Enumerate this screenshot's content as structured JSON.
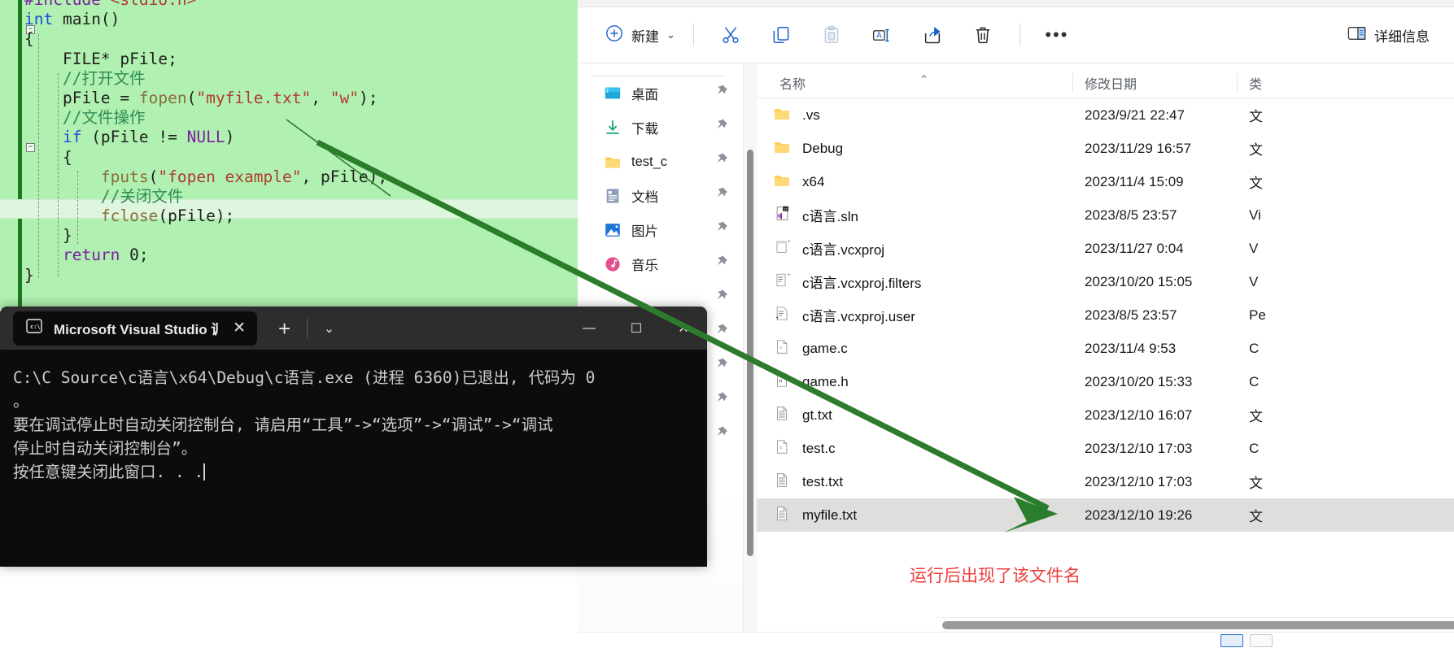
{
  "editor": {
    "lines": [
      {
        "id": "l0",
        "segments": [
          {
            "t": "#include ",
            "c": "pp"
          },
          {
            "t": "<stdio.h>",
            "c": "ppfile"
          }
        ]
      },
      {
        "id": "l1",
        "segments": [
          {
            "t": "int",
            "c": "kw"
          },
          {
            "t": " main()",
            "c": "pl"
          }
        ]
      },
      {
        "id": "l2",
        "segments": [
          {
            "t": "{",
            "c": "pl"
          }
        ]
      },
      {
        "id": "l3",
        "segments": [
          {
            "t": "    FILE* pFile;",
            "c": "pl"
          }
        ]
      },
      {
        "id": "l4",
        "segments": [
          {
            "t": "    //打开文件",
            "c": "cmt"
          }
        ]
      },
      {
        "id": "l5",
        "segments": [
          {
            "t": "    pFile = ",
            "c": "pl"
          },
          {
            "t": "fopen",
            "c": "fn"
          },
          {
            "t": "(",
            "c": "pl"
          },
          {
            "t": "\"myfile.txt\"",
            "c": "str"
          },
          {
            "t": ", ",
            "c": "pl"
          },
          {
            "t": "\"w\"",
            "c": "str"
          },
          {
            "t": ");",
            "c": "pl"
          }
        ]
      },
      {
        "id": "l6",
        "segments": [
          {
            "t": "    //文件操作",
            "c": "cmt"
          }
        ]
      },
      {
        "id": "l7",
        "segments": [
          {
            "t": "    ",
            "c": "pl"
          },
          {
            "t": "if",
            "c": "kw"
          },
          {
            "t": " (pFile != ",
            "c": "pl"
          },
          {
            "t": "NULL",
            "c": "kw2"
          },
          {
            "t": ")",
            "c": "pl"
          }
        ]
      },
      {
        "id": "l8",
        "segments": [
          {
            "t": "    {",
            "c": "pl"
          }
        ]
      },
      {
        "id": "l9",
        "segments": [
          {
            "t": "        ",
            "c": "pl"
          },
          {
            "t": "fputs",
            "c": "fn"
          },
          {
            "t": "(",
            "c": "pl"
          },
          {
            "t": "\"fopen example\"",
            "c": "str"
          },
          {
            "t": ", pFile);",
            "c": "pl"
          }
        ]
      },
      {
        "id": "l10",
        "segments": [
          {
            "t": "        //关闭文件",
            "c": "cmt"
          }
        ]
      },
      {
        "id": "l11",
        "segments": [
          {
            "t": "        ",
            "c": "pl"
          },
          {
            "t": "fclose",
            "c": "fn"
          },
          {
            "t": "(pFile);",
            "c": "pl"
          }
        ]
      },
      {
        "id": "l12",
        "segments": [
          {
            "t": "    }",
            "c": "pl"
          }
        ]
      },
      {
        "id": "l13",
        "segments": [
          {
            "t": "    ",
            "c": "pl"
          },
          {
            "t": "return",
            "c": "kw2"
          },
          {
            "t": " 0;",
            "c": "pl"
          }
        ]
      },
      {
        "id": "l14",
        "segments": [
          {
            "t": "}",
            "c": "pl"
          }
        ]
      }
    ]
  },
  "explorer": {
    "toolbar": {
      "new_label": "新建",
      "new_chevron": "⌄",
      "cut_label": "剪切",
      "copy_label": "复制",
      "paste_label": "粘贴",
      "rename_label": "重命名",
      "share_label": "共享",
      "delete_label": "删除",
      "more_label": "•••",
      "details_label": "详细信息"
    },
    "nav_items": [
      {
        "icon": "desktop-icon",
        "label": "桌面",
        "pinned": true
      },
      {
        "icon": "download-icon",
        "label": "下载",
        "pinned": true
      },
      {
        "icon": "folder-icon",
        "label": "test_c",
        "pinned": true
      },
      {
        "icon": "documents-icon",
        "label": "文档",
        "pinned": true
      },
      {
        "icon": "pictures-icon",
        "label": "图片",
        "pinned": true
      },
      {
        "icon": "music-icon",
        "label": "音乐",
        "pinned": true
      },
      {
        "icon": "blank-icon",
        "label": "",
        "pinned": true
      },
      {
        "icon": "blank-icon",
        "label": "",
        "pinned": true
      },
      {
        "icon": "blank-icon",
        "label": "",
        "pinned": true
      },
      {
        "icon": "blank-icon",
        "label": "",
        "pinned": true
      },
      {
        "icon": "blank-icon",
        "label": "",
        "pinned": true
      }
    ],
    "columns": {
      "name": "名称",
      "date": "修改日期",
      "type": "类"
    },
    "files": [
      {
        "icon": "folder-icon",
        "name": ".vs",
        "date": "2023/9/21 22:47",
        "type": "文",
        "selected": false
      },
      {
        "icon": "folder-icon",
        "name": "Debug",
        "date": "2023/11/29 16:57",
        "type": "文",
        "selected": false
      },
      {
        "icon": "folder-icon",
        "name": "x64",
        "date": "2023/11/4 15:09",
        "type": "文",
        "selected": false
      },
      {
        "icon": "sln-icon",
        "name": "c语言.sln",
        "date": "2023/8/5 23:57",
        "type": "Vi",
        "selected": false
      },
      {
        "icon": "vcxproj-icon",
        "name": "c语言.vcxproj",
        "date": "2023/11/27 0:04",
        "type": "V",
        "selected": false
      },
      {
        "icon": "filters-icon",
        "name": "c语言.vcxproj.filters",
        "date": "2023/10/20 15:05",
        "type": "V",
        "selected": false
      },
      {
        "icon": "user-icon",
        "name": "c语言.vcxproj.user",
        "date": "2023/8/5 23:57",
        "type": "Pe",
        "selected": false
      },
      {
        "icon": "c-icon",
        "name": "game.c",
        "date": "2023/11/4 9:53",
        "type": "C",
        "selected": false
      },
      {
        "icon": "h-icon",
        "name": "game.h",
        "date": "2023/10/20 15:33",
        "type": "C",
        "selected": false
      },
      {
        "icon": "txt-icon",
        "name": "gt.txt",
        "date": "2023/12/10 16:07",
        "type": "文",
        "selected": false
      },
      {
        "icon": "c-icon",
        "name": "test.c",
        "date": "2023/12/10 17:03",
        "type": "C",
        "selected": false
      },
      {
        "icon": "txt-icon",
        "name": "test.txt",
        "date": "2023/12/10 17:03",
        "type": "文",
        "selected": false
      },
      {
        "icon": "txt-icon",
        "name": "myfile.txt",
        "date": "2023/12/10 19:26",
        "type": "文",
        "selected": true
      }
    ]
  },
  "console": {
    "tab_title": "Microsoft Visual Studio 调试控",
    "tab_close": "✕",
    "new_tab": "+",
    "dropdown": "⌄",
    "minimize": "—",
    "maximize": "☐",
    "close": "✕",
    "output": "C:\\C Source\\c语言\\x64\\Debug\\c语言.exe (进程 6360)已退出, 代码为 0\n。\n要在调试停止时自动关闭控制台, 请启用“工具”->“选项”->“调试”->“调试\n停止时自动关闭控制台”。\n按任意键关闭此窗口. . ."
  },
  "annotation": {
    "red_note": "运行后出现了该文件名",
    "red_color": "#ef3b3b",
    "arrow_color": "#2a7d2a"
  }
}
